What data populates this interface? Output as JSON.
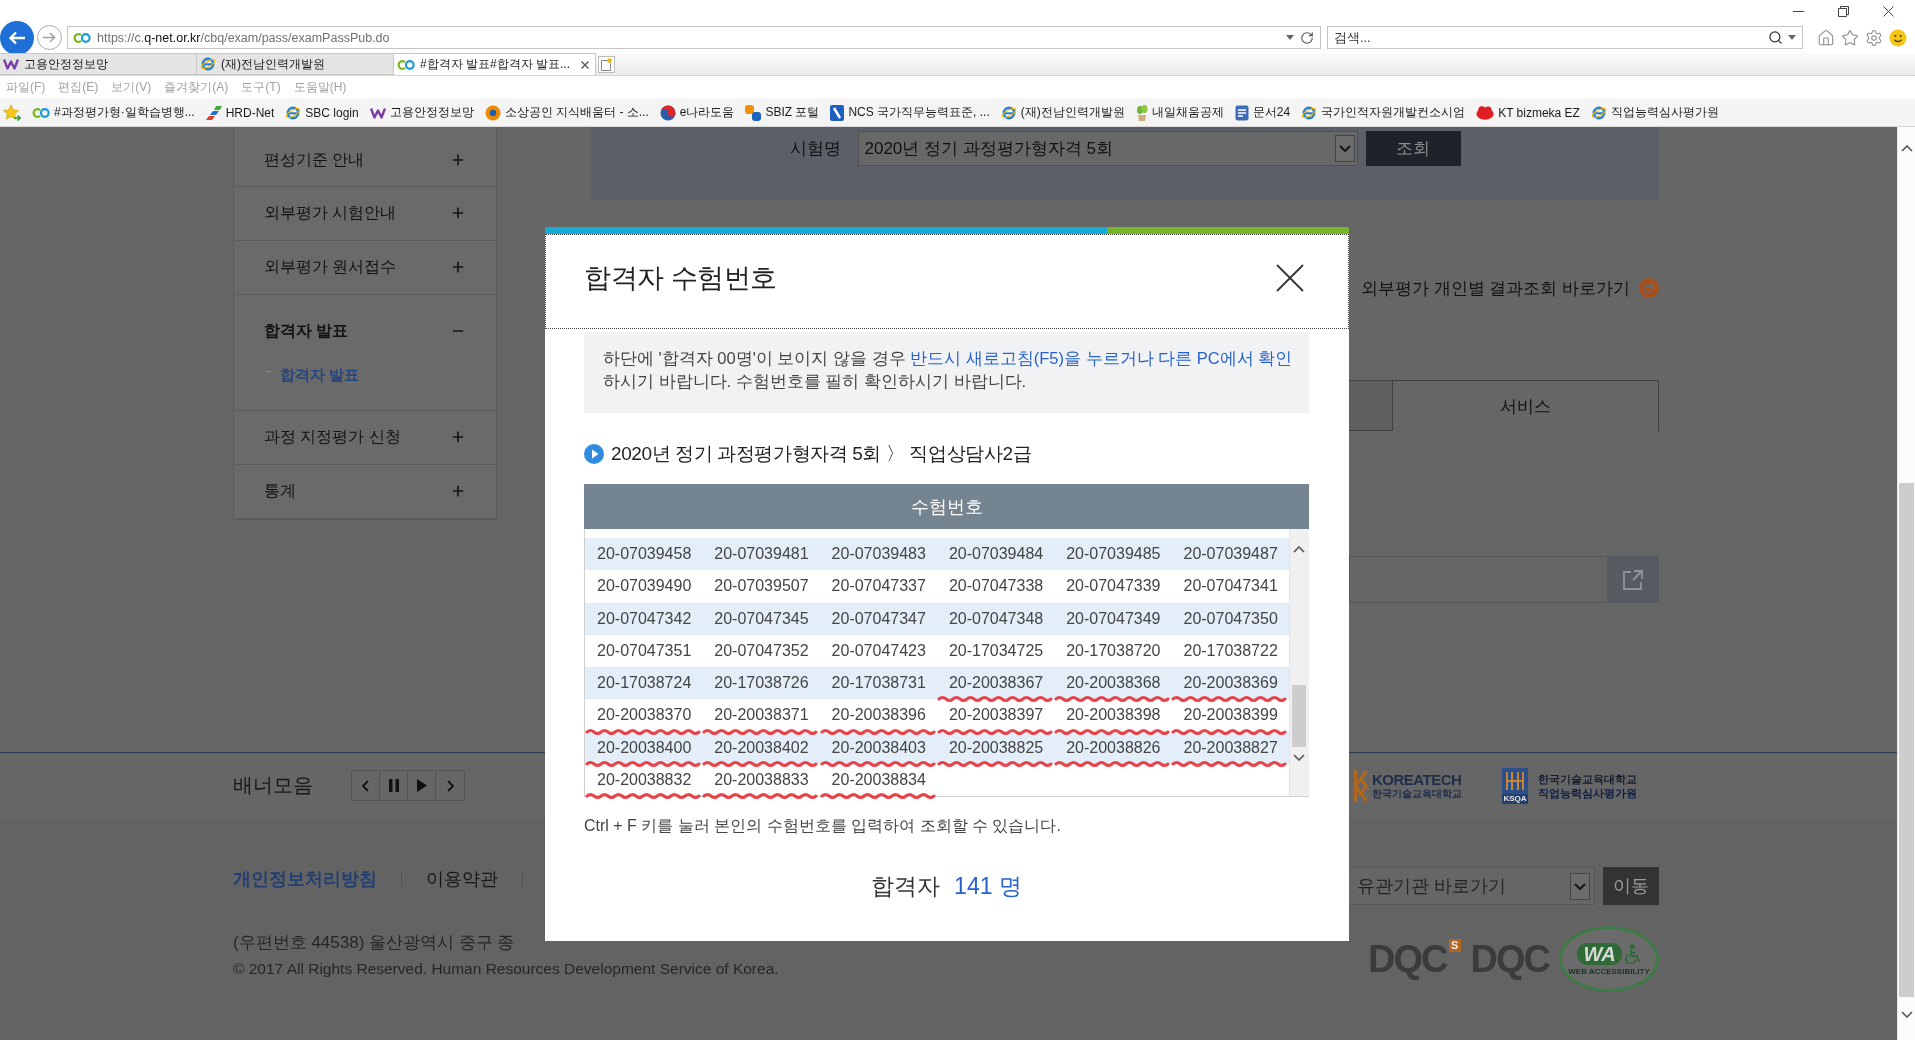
{
  "browser": {
    "url": [
      {
        "text": "https://c.",
        "strong": false
      },
      {
        "text": "q-net.or.kr",
        "strong": true
      },
      {
        "text": "/cbq/exam/pass/examPassPub.do",
        "strong": false
      }
    ],
    "search": {
      "placeholder": "검색..."
    },
    "tabs": [
      {
        "label": "고용안정정보망",
        "selected": false,
        "kind": "w"
      },
      {
        "label": "(재)전남인력개발원",
        "selected": false,
        "kind": "ie"
      },
      {
        "label": "#합격자 발표#합격자 발표...",
        "selected": true,
        "kind": "cq"
      }
    ],
    "menu": [
      "파일(F)",
      "편집(E)",
      "보기(V)",
      "즐겨찾기(A)",
      "도구(T)",
      "도움말(H)"
    ],
    "favorites": [
      {
        "label": "#과정평가형·일학습병행...",
        "kind": "cq"
      },
      {
        "label": "HRD-Net",
        "kind": "hrd"
      },
      {
        "label": "SBC login",
        "kind": "ie"
      },
      {
        "label": "고용안정정보망",
        "kind": "w"
      },
      {
        "label": "소상공인 지식배움터 - 소...",
        "kind": "ring"
      },
      {
        "label": "e나라도움",
        "kind": "taeguk"
      },
      {
        "label": "SBIZ 포털",
        "kind": "sbiz"
      },
      {
        "label": "NCS 국가직무능력표준, ...",
        "kind": "ncs"
      },
      {
        "label": "(재)전남인력개발원",
        "kind": "ie"
      },
      {
        "label": "내일채움공제",
        "kind": "plant"
      },
      {
        "label": "문서24",
        "kind": "doc"
      },
      {
        "label": "국가인적자원개발컨소시엄",
        "kind": "ie"
      },
      {
        "label": "KT bizmeka EZ",
        "kind": "ez"
      },
      {
        "label": "직업능력심사평가원",
        "kind": "ie"
      }
    ]
  },
  "sidebar": {
    "items": [
      {
        "label": "편성기준 안내",
        "expanded": false
      },
      {
        "label": "외부평가 시험안내",
        "expanded": false
      },
      {
        "label": "외부평가 원서접수",
        "expanded": false
      },
      {
        "label": "합격자 발표",
        "expanded": true,
        "children": [
          {
            "label": "합격자 발표",
            "selected": true
          }
        ]
      },
      {
        "label": "과정 지정평가 신청",
        "expanded": false
      },
      {
        "label": "통계",
        "expanded": false
      }
    ]
  },
  "search_panel": {
    "label": "시험명",
    "select": "2020년 정기 과정평가형자격 5회",
    "button": "조회"
  },
  "result_link": "외부평가 개인별 결과조회 바로가기",
  "content_tabs": [
    {
      "selected": false
    },
    {
      "label": "서비스",
      "selected": true
    }
  ],
  "footer": {
    "banner_title": "배너모음",
    "logos": [
      {
        "kind": "wordmark",
        "title": "KOREATECH",
        "subtitle": "한국기술교육대학교"
      },
      {
        "kind": "emblem",
        "emblem": "KSQA",
        "lines": [
          "한국기술교육대학교",
          "직업능력심사평가원"
        ]
      }
    ],
    "links": [
      {
        "label": "개인정보처리방침",
        "strong": true
      },
      {
        "label": "이용약관",
        "strong": false
      }
    ],
    "address": "(우편번호 44538) 울산광역시 중구 종",
    "copyright": "© 2017 All Rights Reserved. Human Resources Development Service of Korea.",
    "related": {
      "value": "유관기관 바로가기",
      "button": "이동"
    },
    "certifications": [
      {
        "text": "DQC",
        "badge": "S"
      },
      {
        "text": "DQC"
      }
    ],
    "accessibility_mark": {
      "title": "WA",
      "caption": "WEB ACCESSIBILITY"
    }
  },
  "dialog": {
    "title": "합격자 수험번호",
    "notice": {
      "lines": [
        [
          {
            "text": "하단에 '합격자 00명'이 보이지 않을 경우 ",
            "highlight": false
          },
          {
            "text": "반드시 새로고침(F5)을 누르거나 다른 PC에서 확인",
            "highlight": true
          }
        ],
        [
          {
            "text": "하시기 바랍니다. 수험번호를 필히 확인하시기 바랍니다.",
            "highlight": false
          }
        ]
      ]
    },
    "heading": "2020년 정기 과정평가형자격 5회 〉 직업상담사2급",
    "table": {
      "columns": [
        "수험번호"
      ],
      "rows": [
        {
          "cells": [
            {
              "number": "20-07039458",
              "underlined": false
            },
            {
              "number": "20-07039481",
              "underlined": false
            },
            {
              "number": "20-07039483",
              "underlined": false
            },
            {
              "number": "20-07039484",
              "underlined": false
            },
            {
              "number": "20-07039485",
              "underlined": false
            },
            {
              "number": "20-07039487",
              "underlined": false
            }
          ]
        },
        {
          "cells": [
            {
              "number": "20-07039490",
              "underlined": false
            },
            {
              "number": "20-07039507",
              "underlined": false
            },
            {
              "number": "20-07047337",
              "underlined": false
            },
            {
              "number": "20-07047338",
              "underlined": false
            },
            {
              "number": "20-07047339",
              "underlined": false
            },
            {
              "number": "20-07047341",
              "underlined": false
            }
          ]
        },
        {
          "cells": [
            {
              "number": "20-07047342",
              "underlined": false
            },
            {
              "number": "20-07047345",
              "underlined": false
            },
            {
              "number": "20-07047347",
              "underlined": false
            },
            {
              "number": "20-07047348",
              "underlined": false
            },
            {
              "number": "20-07047349",
              "underlined": false
            },
            {
              "number": "20-07047350",
              "underlined": false
            }
          ]
        },
        {
          "cells": [
            {
              "number": "20-07047351",
              "underlined": false
            },
            {
              "number": "20-07047352",
              "underlined": false
            },
            {
              "number": "20-07047423",
              "underlined": false
            },
            {
              "number": "20-17034725",
              "underlined": false
            },
            {
              "number": "20-17038720",
              "underlined": false
            },
            {
              "number": "20-17038722",
              "underlined": false
            }
          ]
        },
        {
          "cells": [
            {
              "number": "20-17038724",
              "underlined": false
            },
            {
              "number": "20-17038726",
              "underlined": false
            },
            {
              "number": "20-17038731",
              "underlined": false
            },
            {
              "number": "20-20038367",
              "underlined": true
            },
            {
              "number": "20-20038368",
              "underlined": true
            },
            {
              "number": "20-20038369",
              "underlined": true
            }
          ]
        },
        {
          "cells": [
            {
              "number": "20-20038370",
              "underlined": true
            },
            {
              "number": "20-20038371",
              "underlined": true
            },
            {
              "number": "20-20038396",
              "underlined": true
            },
            {
              "number": "20-20038397",
              "underlined": true
            },
            {
              "number": "20-20038398",
              "underlined": true
            },
            {
              "number": "20-20038399",
              "underlined": true
            }
          ]
        },
        {
          "cells": [
            {
              "number": "20-20038400",
              "underlined": true
            },
            {
              "number": "20-20038402",
              "underlined": true
            },
            {
              "number": "20-20038403",
              "underlined": true
            },
            {
              "number": "20-20038825",
              "underlined": true
            },
            {
              "number": "20-20038826",
              "underlined": true
            },
            {
              "number": "20-20038827",
              "underlined": true
            }
          ]
        },
        {
          "cells": [
            {
              "number": "20-20038832",
              "underlined": true
            },
            {
              "number": "20-20038833",
              "underlined": true
            },
            {
              "number": "20-20038834",
              "underlined": true
            }
          ]
        }
      ]
    },
    "hint": "Ctrl + F 키를 눌러 본인의 수험번호를 입력하여 조회할 수 있습니다.",
    "total": {
      "label": "합격자",
      "count": "141 명"
    }
  }
}
